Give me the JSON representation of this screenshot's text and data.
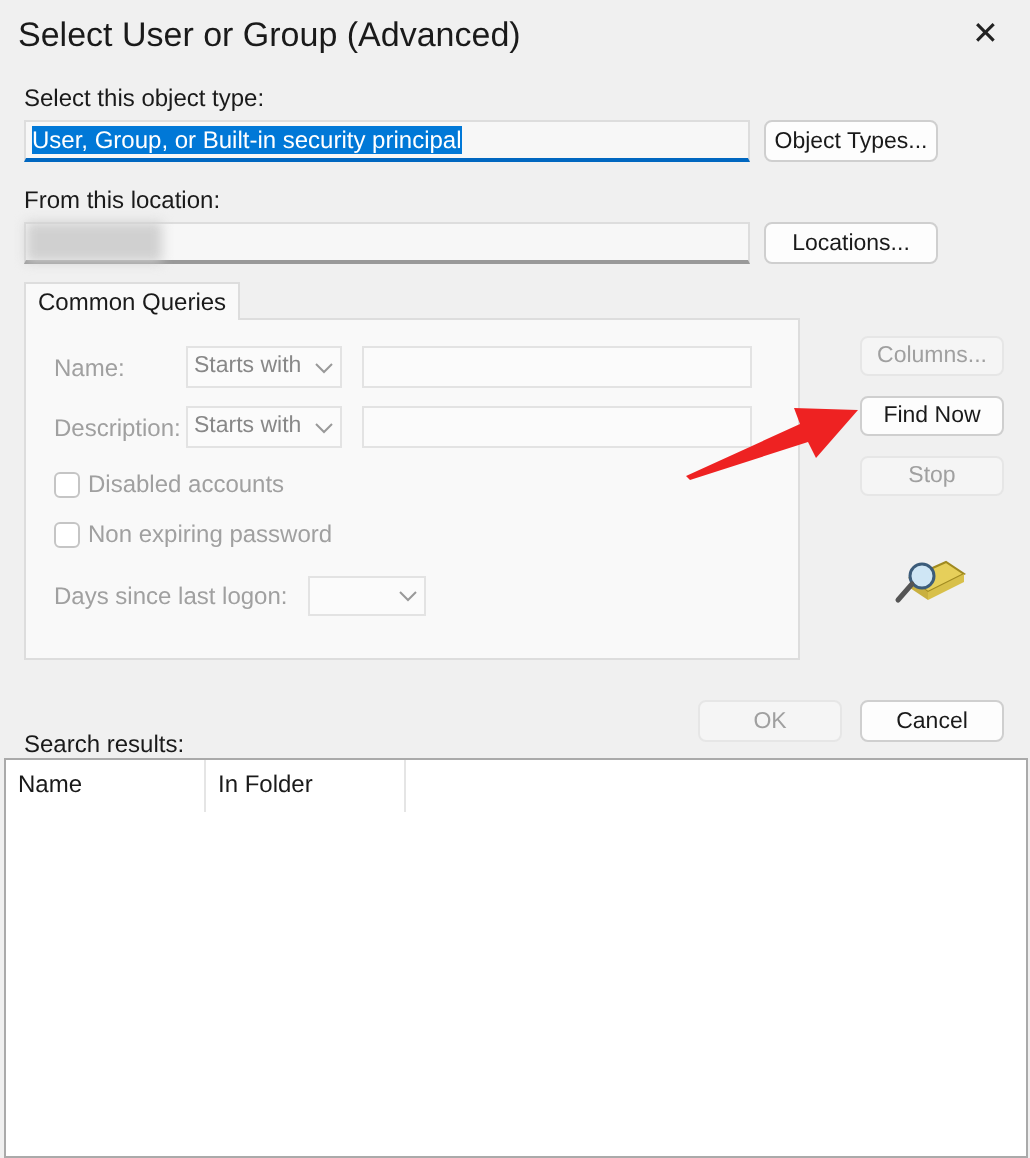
{
  "window": {
    "title": "Select User or Group (Advanced)",
    "close": "✕"
  },
  "object_type": {
    "label": "Select this object type:",
    "value": "User, Group, or Built-in security principal",
    "value_selected": true,
    "button": {
      "label": "Object Types...",
      "disabled": false
    }
  },
  "location": {
    "label": "From this location:",
    "value_hidden": true,
    "button": {
      "label": "Locations...",
      "disabled": false
    }
  },
  "tabs": [
    {
      "label": "Common Queries",
      "selected": true
    }
  ],
  "query": {
    "rows": [
      {
        "label": "Name:",
        "operator": "Starts with",
        "disabled": true
      },
      {
        "label": "Description:",
        "operator": "Starts with",
        "disabled": true
      }
    ],
    "checkboxes": [
      {
        "label": "Disabled accounts",
        "checked": false,
        "disabled": true
      },
      {
        "label": "Non expiring password",
        "checked": false,
        "disabled": true
      }
    ],
    "days": {
      "label": "Days since last logon:",
      "disabled": true
    }
  },
  "side_buttons": [
    {
      "label": "Columns...",
      "disabled": true
    },
    {
      "label": "Find Now",
      "disabled": false
    },
    {
      "label": "Stop",
      "disabled": true
    }
  ],
  "dialog_buttons": [
    {
      "label": "OK",
      "disabled": true
    },
    {
      "label": "Cancel",
      "disabled": false
    }
  ],
  "results": {
    "label": "Search results:",
    "columns": [
      "Name",
      "In Folder"
    ]
  },
  "annotation": {
    "kind": "arrow",
    "color": "#ee2222"
  }
}
